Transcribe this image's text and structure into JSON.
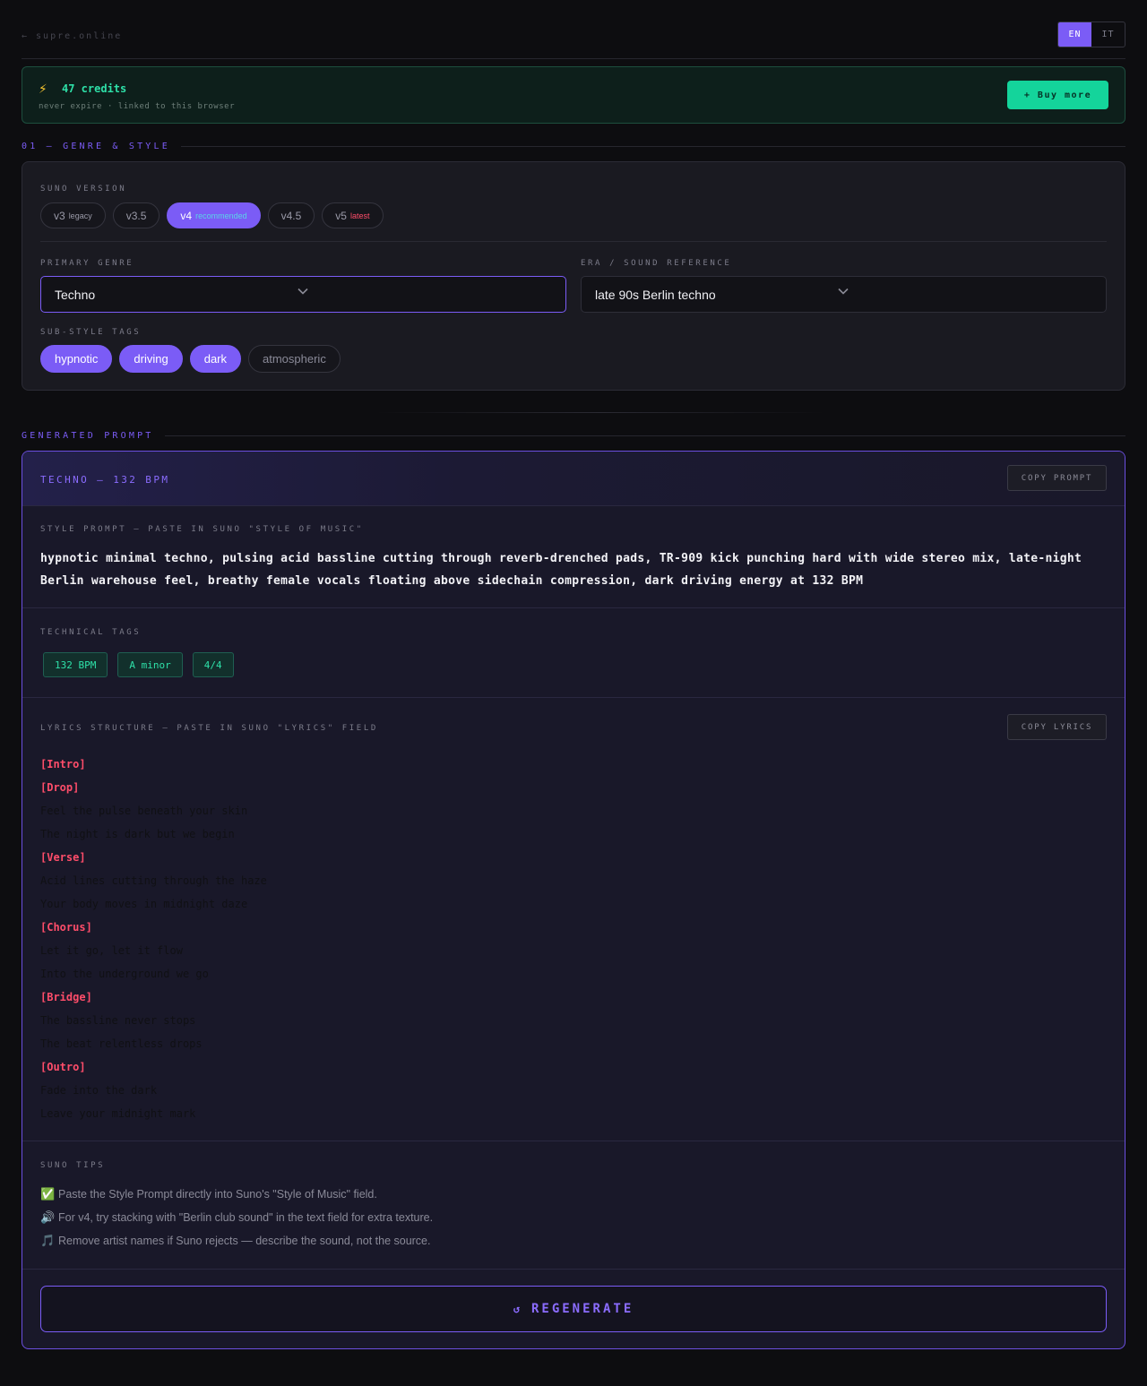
{
  "topbar": {
    "back_link": "← supre.online",
    "languages": [
      {
        "code": "EN",
        "active": true
      },
      {
        "code": "IT",
        "active": false
      }
    ]
  },
  "credits": {
    "icon": "lightning-icon",
    "amount": "47 credits",
    "subtitle": "never expire · linked to this browser",
    "buy_label": "+ Buy more"
  },
  "section_genre": {
    "heading": "01 — GENRE & STYLE",
    "suno_version_label": "SUNO VERSION",
    "versions": [
      {
        "name": "v3",
        "note": "legacy",
        "active": false
      },
      {
        "name": "v3.5",
        "note": "",
        "active": false
      },
      {
        "name": "v4",
        "note": "recommended",
        "active": true
      },
      {
        "name": "v4.5",
        "note": "",
        "active": false
      },
      {
        "name": "v5",
        "note": "latest",
        "active": false
      }
    ],
    "primary_genre_label": "PRIMARY GENRE",
    "primary_genre_value": "Techno",
    "era_label": "ERA / SOUND REFERENCE",
    "era_value": "late 90s Berlin techno",
    "substyle_label": "SUB-STYLE TAGS",
    "substyles": [
      {
        "name": "hypnotic",
        "active": true
      },
      {
        "name": "driving",
        "active": true
      },
      {
        "name": "dark",
        "active": true
      },
      {
        "name": "atmospheric",
        "active": false
      }
    ]
  },
  "generated": {
    "heading": "GENERATED PROMPT",
    "card_title": "TECHNO — 132 BPM",
    "copy_prompt_label": "COPY PROMPT",
    "style_label": "STYLE PROMPT — PASTE IN SUNO \"STYLE OF MUSIC\"",
    "style_text": "hypnotic minimal techno, pulsing acid bassline cutting through reverb-drenched pads, TR-909 kick punching hard with wide stereo mix, late-night Berlin warehouse feel, breathy female vocals floating above sidechain compression, dark driving energy at 132 BPM",
    "technical_label": "TECHNICAL TAGS",
    "technical_tags": [
      "132 BPM",
      "A minor",
      "4/4"
    ],
    "lyrics_label": "LYRICS STRUCTURE — PASTE IN SUNO \"LYRICS\" FIELD",
    "copy_lyrics_label": "COPY LYRICS",
    "lyrics": [
      {
        "text": "[Intro]",
        "kind": "section"
      },
      {
        "text": "[Drop]",
        "kind": "section"
      },
      {
        "text": "Feel the pulse beneath your skin",
        "kind": "line"
      },
      {
        "text": "The night is dark but we begin",
        "kind": "line"
      },
      {
        "text": "[Verse]",
        "kind": "section"
      },
      {
        "text": "Acid lines cutting through the haze",
        "kind": "line"
      },
      {
        "text": "Your body moves in midnight daze",
        "kind": "line"
      },
      {
        "text": "[Chorus]",
        "kind": "section"
      },
      {
        "text": "Let it go, let it flow",
        "kind": "line"
      },
      {
        "text": "Into the underground we go",
        "kind": "line"
      },
      {
        "text": "[Bridge]",
        "kind": "section"
      },
      {
        "text": "The bassline never stops",
        "kind": "line"
      },
      {
        "text": "The beat relentless drops",
        "kind": "line"
      },
      {
        "text": "[Outro]",
        "kind": "section"
      },
      {
        "text": "Fade into the dark",
        "kind": "line"
      },
      {
        "text": "Leave your midnight mark",
        "kind": "line"
      }
    ],
    "tips_label": "SUNO TIPS",
    "tips": [
      {
        "icon": "check-icon",
        "glyph": "✅",
        "text": "Paste the Style Prompt directly into Suno's \"Style of Music\" field."
      },
      {
        "icon": "speaker-icon",
        "glyph": "🔊",
        "text": "For v4, try stacking with \"Berlin club sound\" in the text field for extra texture."
      },
      {
        "icon": "music-note-icon",
        "glyph": "🎵",
        "text": "Remove artist names if Suno rejects — describe the sound, not the source."
      }
    ],
    "regenerate_label": "REGENERATE"
  },
  "colors": {
    "accent": "#7b5cf6",
    "green": "#14d49b",
    "red": "#ff4d6a",
    "background": "#0d0d10"
  }
}
